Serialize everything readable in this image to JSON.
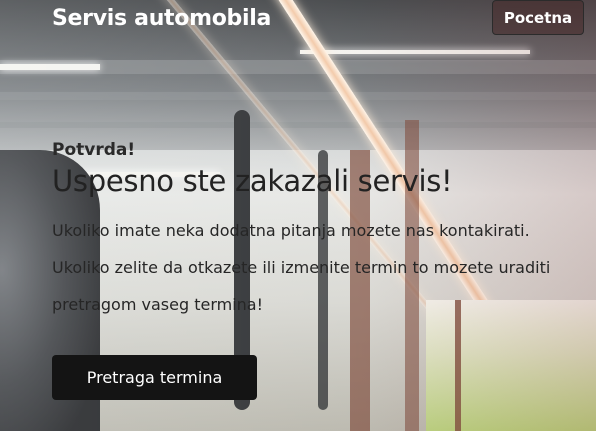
{
  "header": {
    "brand": "Servis automobila",
    "home_label": "Pocetna"
  },
  "confirmation": {
    "kicker": "Potvrda!",
    "headline": "Uspesno ste zakazali servis!",
    "message": "Ukoliko imate neka dodatna pitanja mozete nas kontakirati. Ukoliko zelite da otkazete ili izmenite termin to mozete uraditi pretragom vaseg termina!",
    "search_button_label": "Pretraga termina"
  },
  "colors": {
    "button_dark": "#141414",
    "text_dark": "#222222",
    "brand_text": "#ffffff"
  }
}
